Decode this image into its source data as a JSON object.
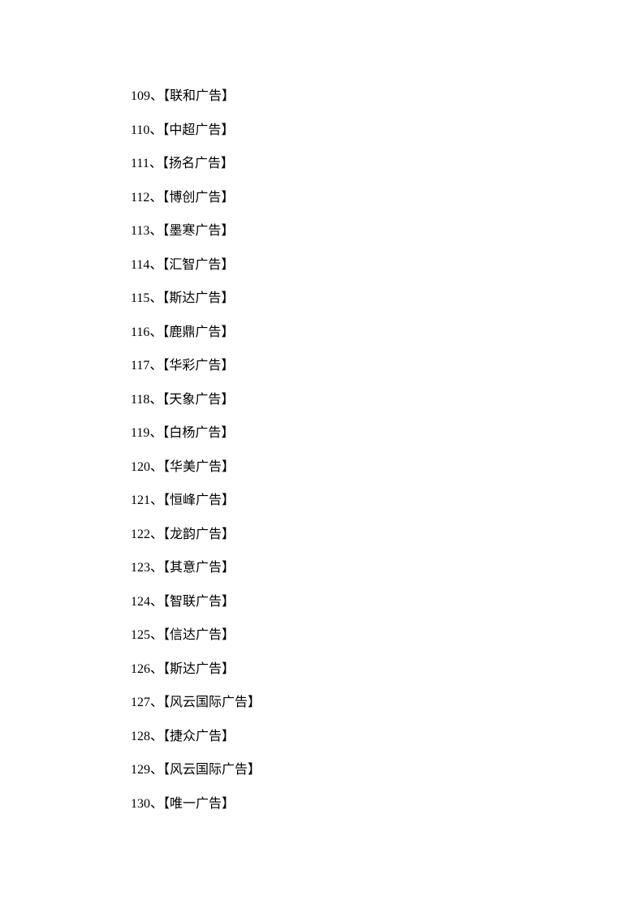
{
  "items": [
    {
      "num": "109",
      "name": "联和广告"
    },
    {
      "num": "110",
      "name": "中超广告"
    },
    {
      "num": "111",
      "name": "扬名广告"
    },
    {
      "num": "112",
      "name": "博创广告"
    },
    {
      "num": "113",
      "name": "墨寒广告"
    },
    {
      "num": "114",
      "name": "汇智广告"
    },
    {
      "num": "115",
      "name": "斯达广告"
    },
    {
      "num": "116",
      "name": "鹿鼎广告"
    },
    {
      "num": "117",
      "name": "华彩广告"
    },
    {
      "num": "118",
      "name": "天象广告"
    },
    {
      "num": "119",
      "name": "白杨广告"
    },
    {
      "num": "120",
      "name": "华美广告"
    },
    {
      "num": "121",
      "name": "恒峰广告"
    },
    {
      "num": "122",
      "name": "龙韵广告"
    },
    {
      "num": "123",
      "name": "其意广告"
    },
    {
      "num": "124",
      "name": "智联广告"
    },
    {
      "num": "125",
      "name": "信达广告"
    },
    {
      "num": "126",
      "name": "斯达广告"
    },
    {
      "num": "127",
      "name": "风云国际广告"
    },
    {
      "num": "128",
      "name": "捷众广告"
    },
    {
      "num": "129",
      "name": "风云国际广告"
    },
    {
      "num": "130",
      "name": "唯一广告"
    }
  ],
  "separator": "、",
  "bracket_open": "【",
  "bracket_close": "】"
}
